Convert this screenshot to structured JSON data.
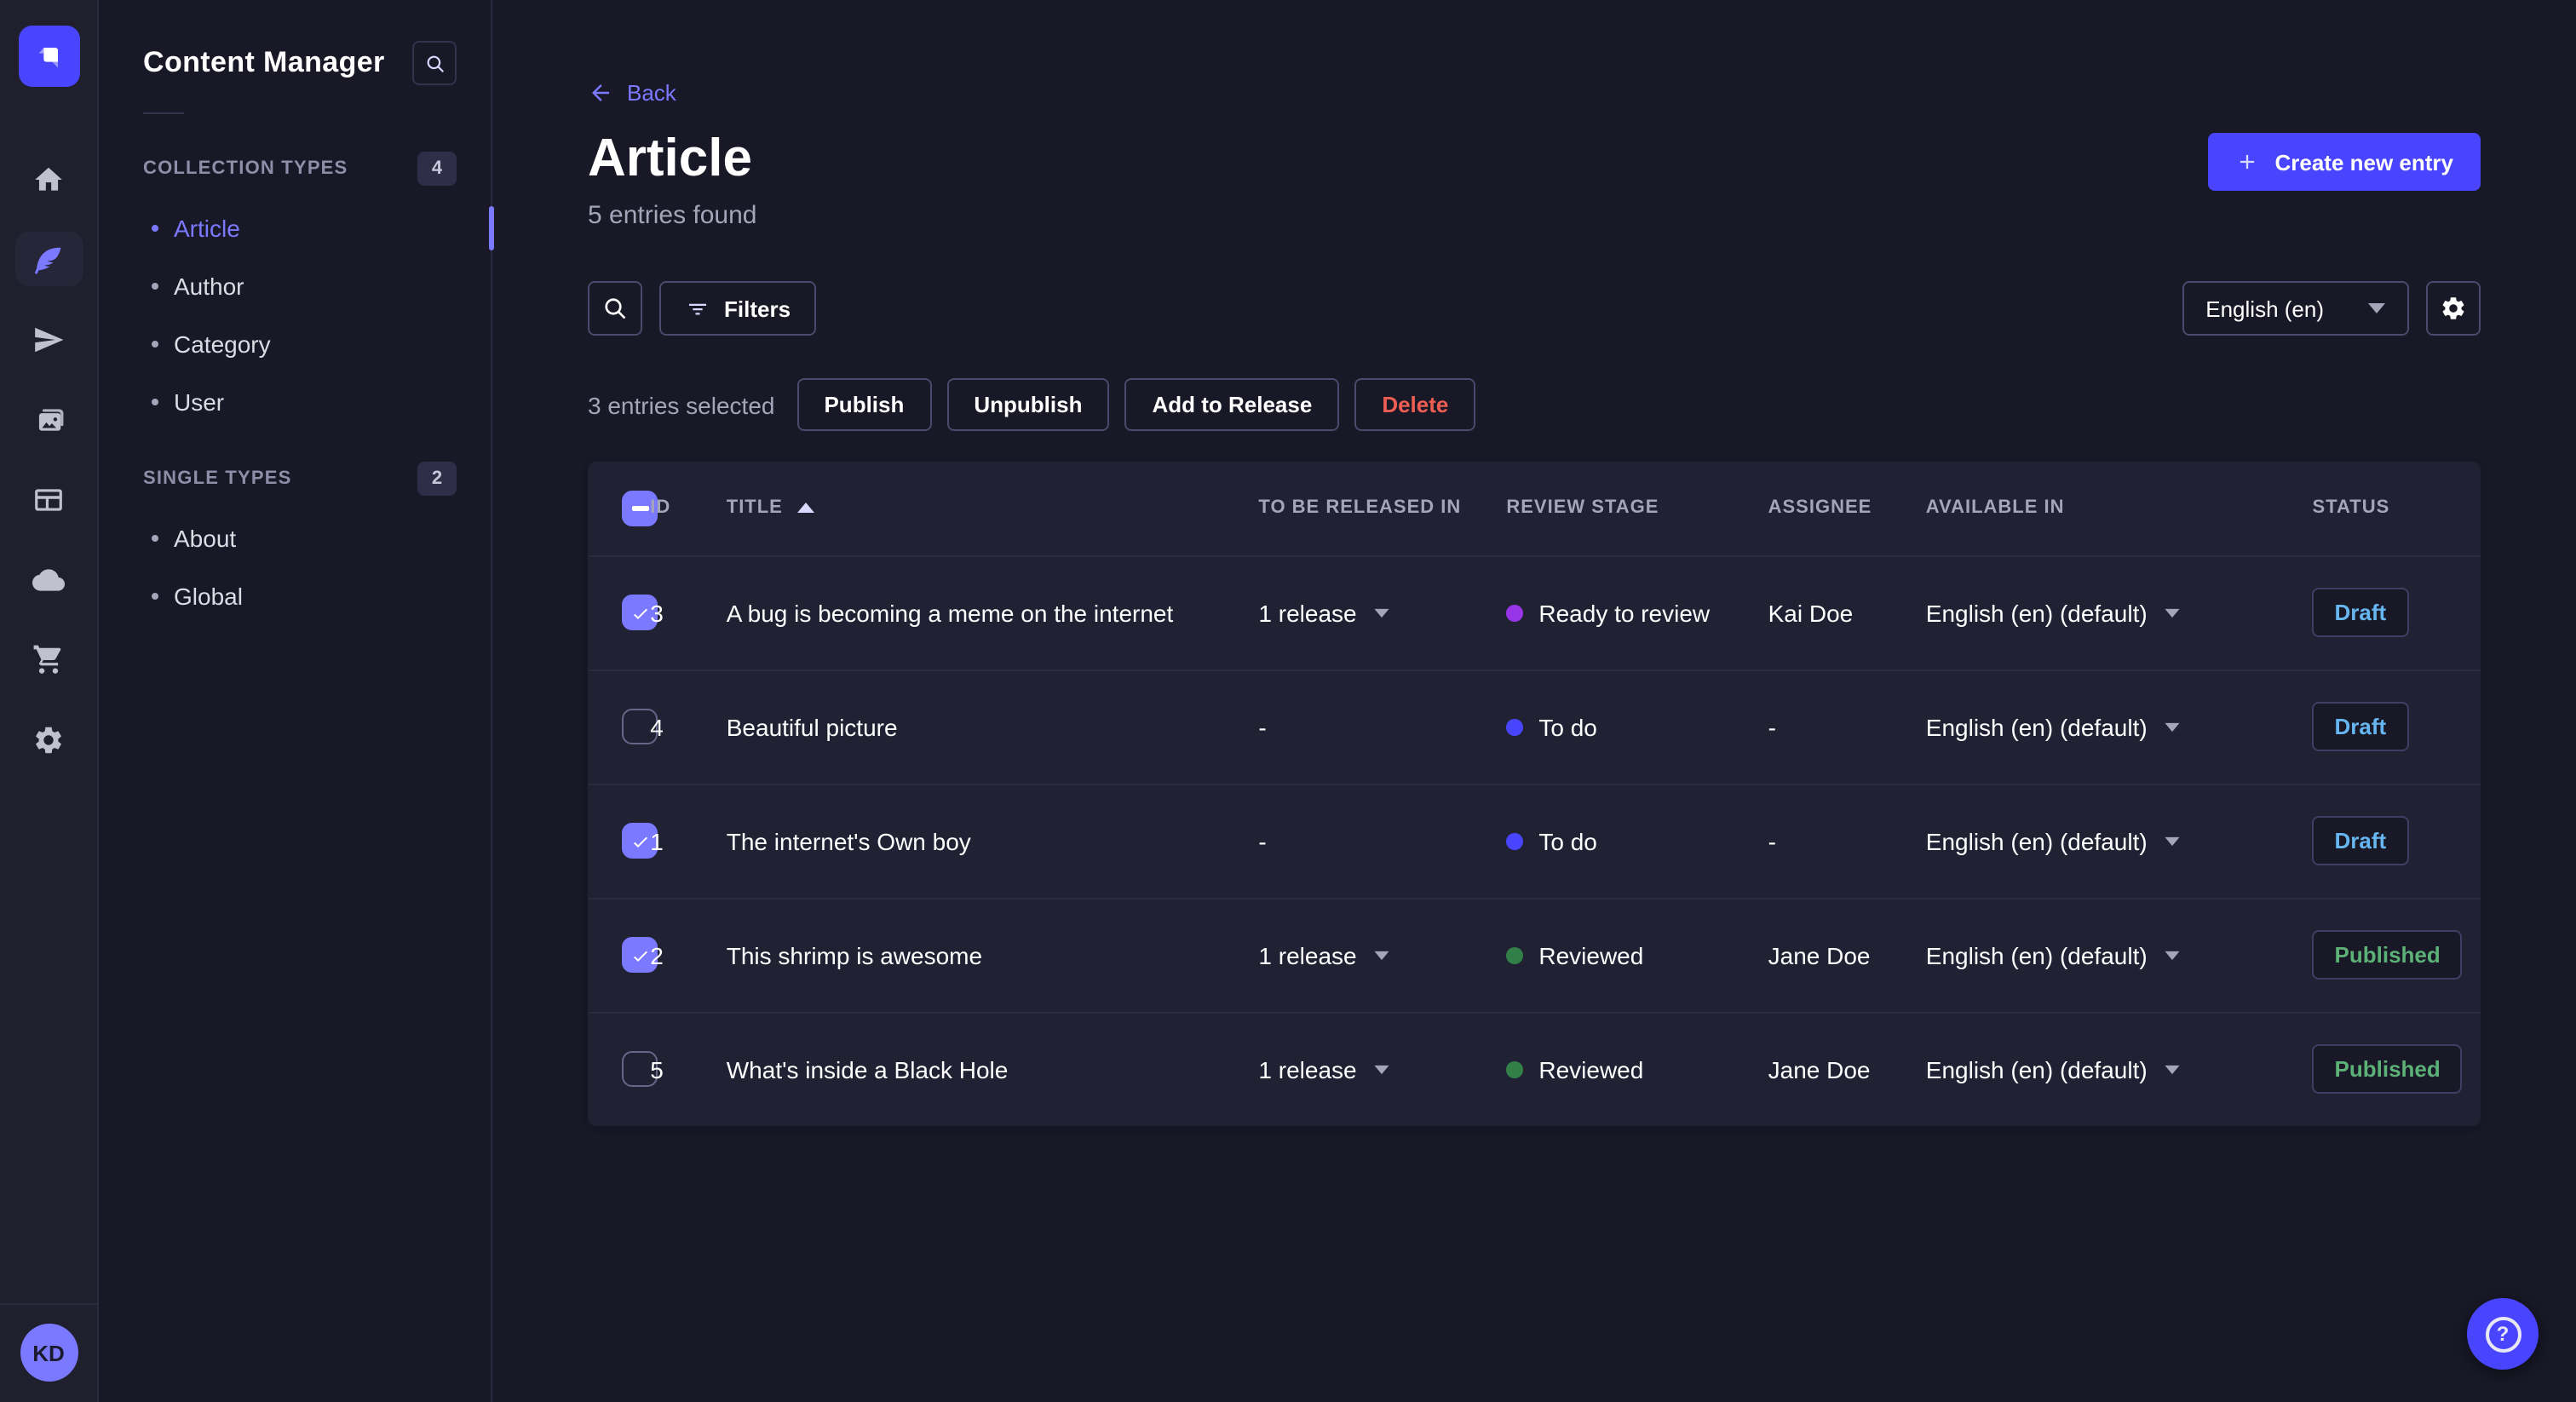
{
  "rail": {
    "items": [
      {
        "name": "home-icon",
        "active": false
      },
      {
        "name": "content-manager-icon",
        "active": true
      },
      {
        "name": "deploy-icon",
        "active": false
      },
      {
        "name": "media-library-icon",
        "active": false
      },
      {
        "name": "content-type-builder-icon",
        "active": false
      },
      {
        "name": "cloud-icon",
        "active": false
      },
      {
        "name": "marketplace-icon",
        "active": false
      },
      {
        "name": "settings-icon",
        "active": false
      }
    ],
    "avatar_initials": "KD"
  },
  "sidebar": {
    "title": "Content Manager",
    "sections": [
      {
        "label": "COLLECTION TYPES",
        "count": "4",
        "items": [
          {
            "label": "Article",
            "active": true
          },
          {
            "label": "Author",
            "active": false
          },
          {
            "label": "Category",
            "active": false
          },
          {
            "label": "User",
            "active": false
          }
        ]
      },
      {
        "label": "SINGLE TYPES",
        "count": "2",
        "items": [
          {
            "label": "About",
            "active": false
          },
          {
            "label": "Global",
            "active": false
          }
        ]
      }
    ]
  },
  "header": {
    "back_label": "Back",
    "title": "Article",
    "subtitle": "5 entries found",
    "create_button_label": "Create new entry"
  },
  "toolbar": {
    "filters_label": "Filters",
    "locale_selected": "English (en)"
  },
  "selection": {
    "text": "3 entries selected",
    "publish_label": "Publish",
    "unpublish_label": "Unpublish",
    "add_to_release_label": "Add to Release",
    "delete_label": "Delete"
  },
  "table": {
    "header_checkbox_state": "indeterminate",
    "headers": {
      "id": "ID",
      "title": "TITLE",
      "released": "TO BE RELEASED IN",
      "stage": "REVIEW STAGE",
      "assignee": "ASSIGNEE",
      "available": "AVAILABLE IN",
      "status": "STATUS"
    },
    "sort": {
      "column": "TITLE",
      "direction": "asc"
    },
    "rows": [
      {
        "checked": true,
        "id": "3",
        "title": "A bug is becoming a meme on the internet",
        "released": "1 release",
        "stage": "Ready to review",
        "stage_color": "#9736E8",
        "assignee": "Kai Doe",
        "available": "English (en) (default)",
        "status": "Draft",
        "status_variant": "draft"
      },
      {
        "checked": false,
        "id": "4",
        "title": "Beautiful picture",
        "released": "-",
        "stage": "To do",
        "stage_color": "#4945FF",
        "assignee": "-",
        "available": "English (en) (default)",
        "status": "Draft",
        "status_variant": "draft"
      },
      {
        "checked": true,
        "id": "1",
        "title": "The internet's Own boy",
        "released": "-",
        "stage": "To do",
        "stage_color": "#4945FF",
        "assignee": "-",
        "available": "English (en) (default)",
        "status": "Draft",
        "status_variant": "draft"
      },
      {
        "checked": true,
        "id": "2",
        "title": "This shrimp is awesome",
        "released": "1 release",
        "stage": "Reviewed",
        "stage_color": "#328048",
        "assignee": "Jane Doe",
        "available": "English (en) (default)",
        "status": "Published",
        "status_variant": "published"
      },
      {
        "checked": false,
        "id": "5",
        "title": "What's inside a Black Hole",
        "released": "1 release",
        "stage": "Reviewed",
        "stage_color": "#328048",
        "assignee": "Jane Doe",
        "available": "English (en) (default)",
        "status": "Published",
        "status_variant": "published"
      }
    ]
  },
  "colors": {
    "primary": "#4945FF",
    "primary_light": "#7B79FF",
    "page_bg": "#181826",
    "card_bg": "#212134",
    "draft_text": "#66B7F1",
    "published_text": "#5CB176",
    "danger_text": "#EE5E52"
  }
}
